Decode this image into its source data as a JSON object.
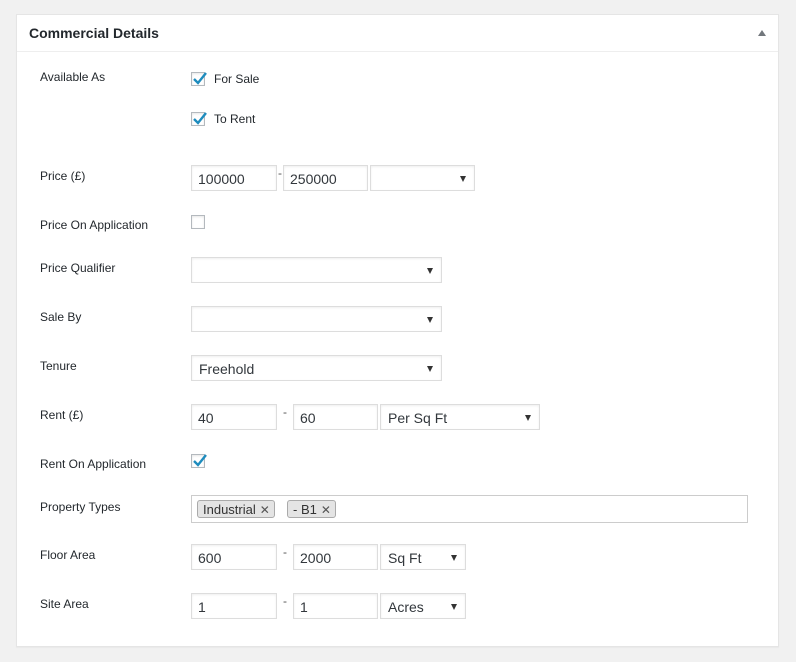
{
  "panel": {
    "title": "Commercial Details"
  },
  "available_as": {
    "label": "Available As",
    "for_sale": {
      "label": "For Sale",
      "checked": true
    },
    "to_rent": {
      "label": "To Rent",
      "checked": true
    }
  },
  "price": {
    "label": "Price (£)",
    "from": "100000",
    "separator": "-",
    "to": "250000",
    "unit": ""
  },
  "price_on_application": {
    "label": "Price On Application",
    "checked": false
  },
  "price_qualifier": {
    "label": "Price Qualifier",
    "value": ""
  },
  "sale_by": {
    "label": "Sale By",
    "value": ""
  },
  "tenure": {
    "label": "Tenure",
    "value": "Freehold"
  },
  "rent": {
    "label": "Rent (£)",
    "from": "40",
    "separator": "-",
    "to": "60",
    "unit": "Per Sq Ft"
  },
  "rent_on_application": {
    "label": "Rent On Application",
    "checked": true
  },
  "property_types": {
    "label": "Property Types",
    "tags": [
      "Industrial",
      "- B1"
    ],
    "remove_glyph": "✕"
  },
  "floor_area": {
    "label": "Floor Area",
    "from": "600",
    "separator": "-",
    "to": "2000",
    "unit": "Sq Ft"
  },
  "site_area": {
    "label": "Site Area",
    "from": "1",
    "separator": "-",
    "to": "1",
    "unit": "Acres"
  },
  "colors": {
    "checkmark": "#1e8cbe"
  }
}
